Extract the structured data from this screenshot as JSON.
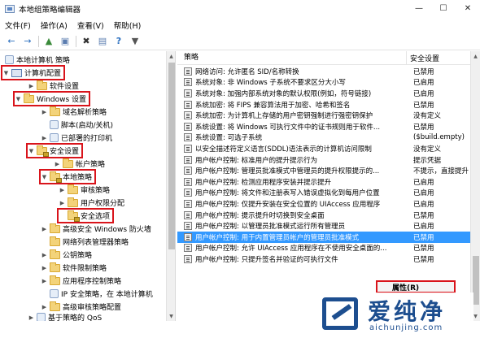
{
  "window": {
    "title": "本地组策略编辑器",
    "minimize": "—",
    "maximize": "☐",
    "close": "✕"
  },
  "menu": [
    "文件(F)",
    "操作(A)",
    "查看(V)",
    "帮助(H)"
  ],
  "toolbar": {
    "back": "←",
    "forward": "→",
    "up": "▲",
    "show_hide": "▣",
    "delete": "✖",
    "properties": "▤",
    "help": "?",
    "filter": "▼"
  },
  "tree": {
    "root": "本地计算机 策略",
    "computer_config": "计算机配置",
    "software_settings": "软件设置",
    "windows_settings": "Windows 设置",
    "dns_policy": "域名解析策略",
    "scripts": "脚本(启动/关机)",
    "printers": "已部署的打印机",
    "security_settings": "安全设置",
    "account_policies": "帐户策略",
    "local_policies": "本地策略",
    "audit_policy": "审核策略",
    "user_rights": "用户权限分配",
    "security_options": "安全选项",
    "firewall": "高级安全 Windows 防火墙",
    "network_list": "网络列表管理器策略",
    "public_key": "公钥策略",
    "software_restriction": "软件限制策略",
    "app_control": "应用程序控制策略",
    "ip_security": "IP 安全策略，在 本地计算机",
    "audit_config": "高级审核策略配置",
    "qos": "基于策略的 QoS"
  },
  "policy_table": {
    "header_policy": "策略",
    "header_setting": "安全设置",
    "rows": [
      {
        "name": "网络访问: 允许匿名 SID/名称转换",
        "setting": "已禁用"
      },
      {
        "name": "系统对象: 非 Windows 子系统不要求区分大小写",
        "setting": "已启用"
      },
      {
        "name": "系统对象: 加强内部系统对象的默认权限(例如，符号链接)",
        "setting": "已启用"
      },
      {
        "name": "系统加密: 将 FIPS 兼容算法用于加密、哈希和签名",
        "setting": "已禁用"
      },
      {
        "name": "系统加密: 为计算机上存储的用户密钥强制进行强密钥保护",
        "setting": "没有定义"
      },
      {
        "name": "系统设置: 将 Windows 可执行文件中的证书规则用于软件...",
        "setting": "已禁用"
      },
      {
        "name": "系统设置: 可选子系统",
        "setting": "($build.empty)"
      },
      {
        "name": "以安全描述符定义语言(SDDL)语法表示的计算机访问限制",
        "setting": "没有定义"
      },
      {
        "name": "用户帐户控制: 标准用户的提升提示行为",
        "setting": "提示凭据"
      },
      {
        "name": "用户帐户控制: 管理员批准模式中管理员的提升权限提示的...",
        "setting": "不提示，直接提升"
      },
      {
        "name": "用户帐户控制: 检测应用程序安装并提示提升",
        "setting": "已启用"
      },
      {
        "name": "用户帐户控制: 将文件和注册表写入错误虚拟化到每用户位置",
        "setting": "已启用"
      },
      {
        "name": "用户帐户控制: 仅提升安装在安全位置的 UIAccess 应用程序",
        "setting": "已启用"
      },
      {
        "name": "用户帐户控制: 提示提升时切换到安全桌面",
        "setting": "已禁用"
      },
      {
        "name": "用户帐户控制: 以管理员批准模式运行所有管理员",
        "setting": "已启用"
      },
      {
        "name": "用户帐户控制: 用于内置管理员帐户的管理员批准模式",
        "setting": "已禁用"
      },
      {
        "name": "用户帐户控制: 允许 UIAccess 应用程序在不使用安全桌面的...",
        "setting": "已禁用"
      },
      {
        "name": "用户帐户控制: 只提升签名并验证的可执行文件",
        "setting": "已禁用"
      }
    ]
  },
  "context_menu": {
    "properties": "属性(R)"
  },
  "watermark": {
    "brand": "爱纯净",
    "url": "aichunjing.com"
  },
  "scrollbar": {
    "up": "▲",
    "down": "▼"
  },
  "colors": {
    "selection": "#3399ff",
    "highlight_box": "#d9141b",
    "watermark": "#1d4e8f"
  }
}
